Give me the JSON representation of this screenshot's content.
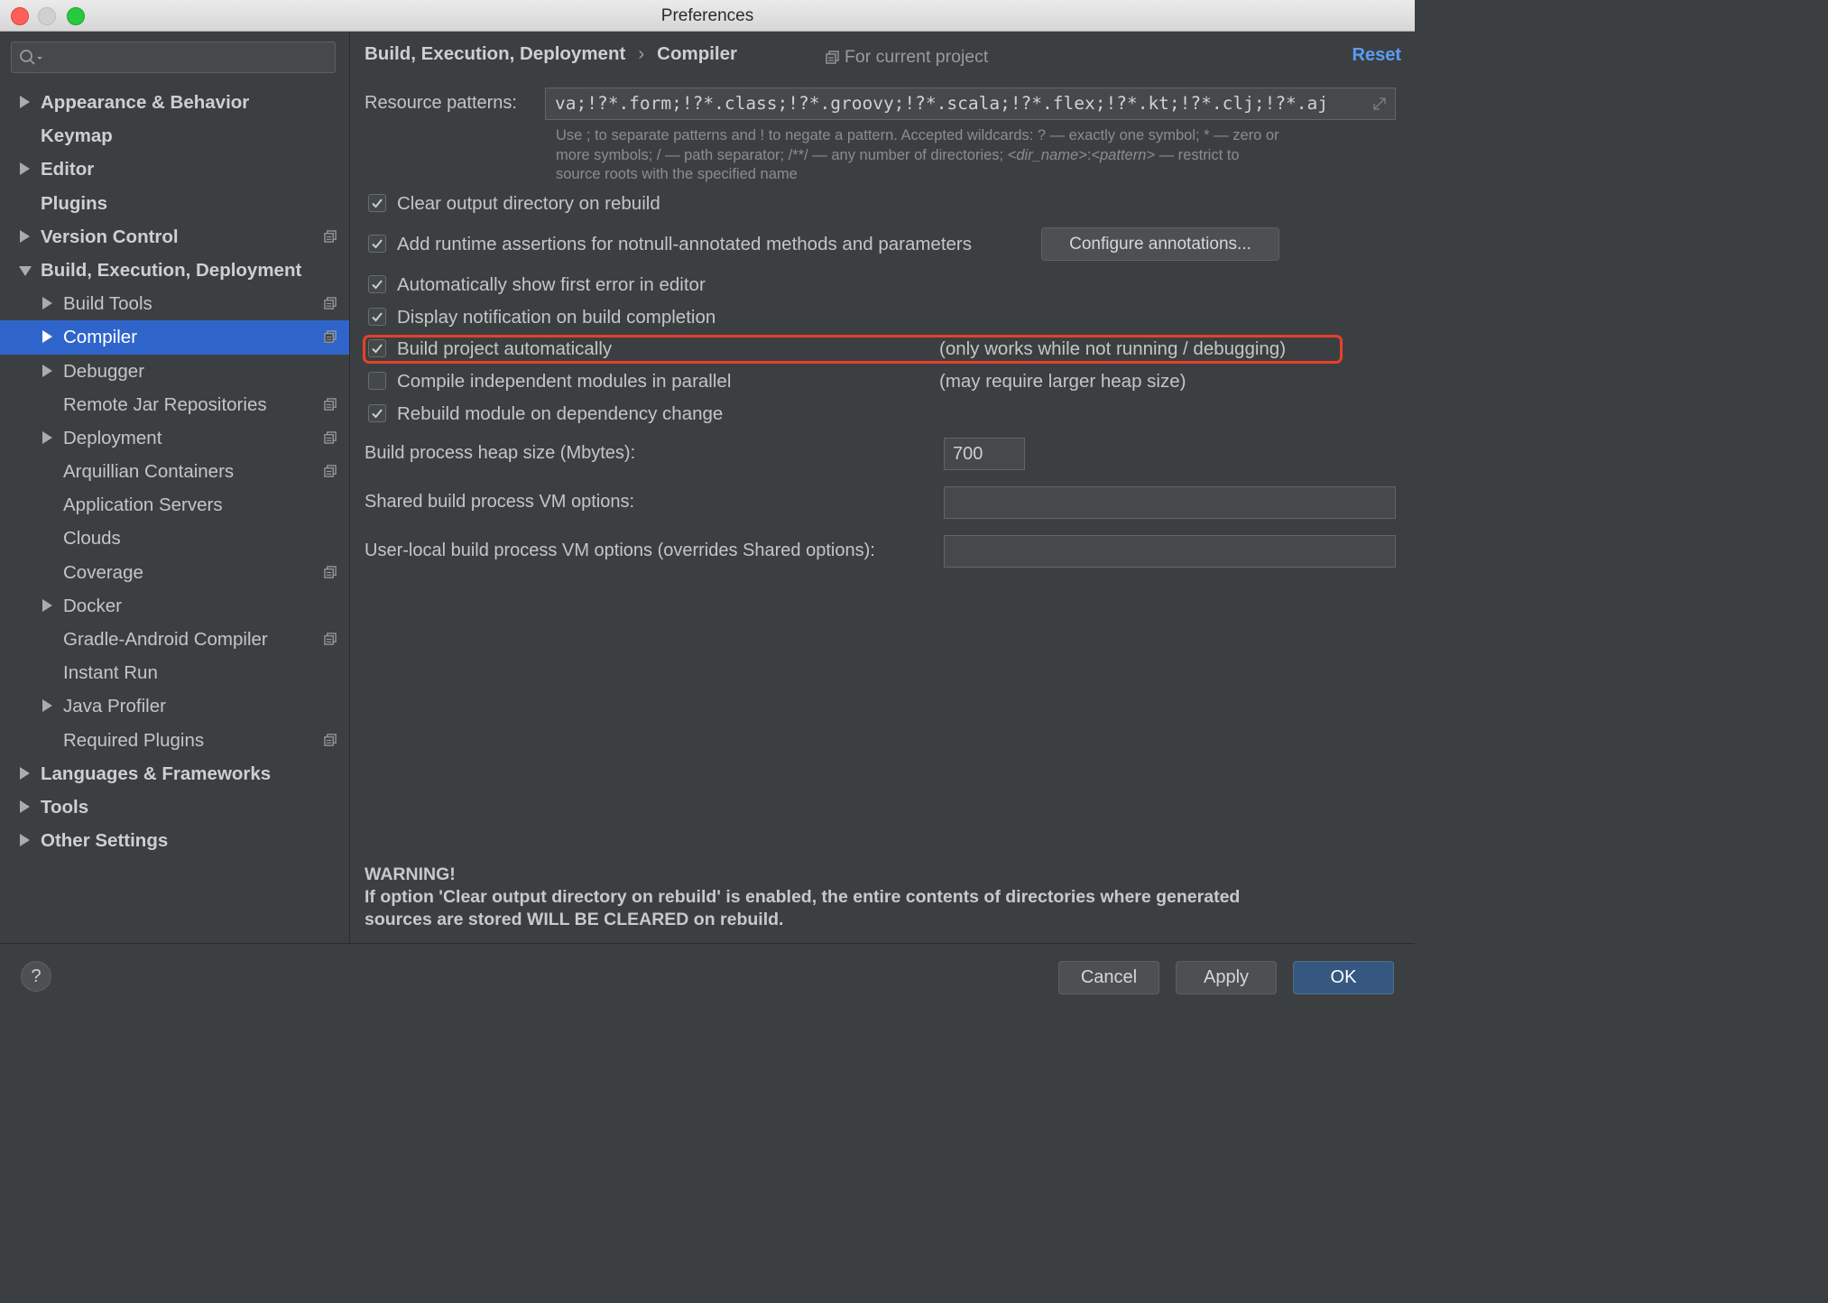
{
  "window": {
    "title": "Preferences"
  },
  "sidebar": {
    "search": {
      "placeholder": ""
    },
    "items": [
      {
        "label": "Appearance & Behavior",
        "level": 0,
        "arrow": "right",
        "project_scope": false
      },
      {
        "label": "Keymap",
        "level": 0,
        "arrow": "none",
        "project_scope": false
      },
      {
        "label": "Editor",
        "level": 0,
        "arrow": "right",
        "project_scope": false
      },
      {
        "label": "Plugins",
        "level": 0,
        "arrow": "none",
        "project_scope": false
      },
      {
        "label": "Version Control",
        "level": 0,
        "arrow": "right",
        "project_scope": true
      },
      {
        "label": "Build, Execution, Deployment",
        "level": 0,
        "arrow": "down",
        "project_scope": false
      },
      {
        "label": "Build Tools",
        "level": 1,
        "arrow": "right",
        "project_scope": true
      },
      {
        "label": "Compiler",
        "level": 1,
        "arrow": "right",
        "project_scope": true,
        "selected": true
      },
      {
        "label": "Debugger",
        "level": 1,
        "arrow": "right",
        "project_scope": false
      },
      {
        "label": "Remote Jar Repositories",
        "level": 1,
        "arrow": "none",
        "project_scope": true
      },
      {
        "label": "Deployment",
        "level": 1,
        "arrow": "right",
        "project_scope": true
      },
      {
        "label": "Arquillian Containers",
        "level": 1,
        "arrow": "none",
        "project_scope": true
      },
      {
        "label": "Application Servers",
        "level": 1,
        "arrow": "none",
        "project_scope": false
      },
      {
        "label": "Clouds",
        "level": 1,
        "arrow": "none",
        "project_scope": false
      },
      {
        "label": "Coverage",
        "level": 1,
        "arrow": "none",
        "project_scope": true
      },
      {
        "label": "Docker",
        "level": 1,
        "arrow": "right",
        "project_scope": false
      },
      {
        "label": "Gradle-Android Compiler",
        "level": 1,
        "arrow": "none",
        "project_scope": true
      },
      {
        "label": "Instant Run",
        "level": 1,
        "arrow": "none",
        "project_scope": false
      },
      {
        "label": "Java Profiler",
        "level": 1,
        "arrow": "right",
        "project_scope": false
      },
      {
        "label": "Required Plugins",
        "level": 1,
        "arrow": "none",
        "project_scope": true
      },
      {
        "label": "Languages & Frameworks",
        "level": 0,
        "arrow": "right",
        "project_scope": false
      },
      {
        "label": "Tools",
        "level": 0,
        "arrow": "right",
        "project_scope": false
      },
      {
        "label": "Other Settings",
        "level": 0,
        "arrow": "right",
        "project_scope": false
      }
    ]
  },
  "header": {
    "breadcrumb_parent": "Build, Execution, Deployment",
    "breadcrumb_separator": "›",
    "breadcrumb_current": "Compiler",
    "scope_label": "For current project",
    "reset_label": "Reset"
  },
  "compiler": {
    "resource_patterns_label": "Resource patterns:",
    "resource_patterns_value": "va;!?*.form;!?*.class;!?*.groovy;!?*.scala;!?*.flex;!?*.kt;!?*.clj;!?*.aj",
    "hint_line1": "Use ; to separate patterns and ! to negate a pattern. Accepted wildcards: ? — exactly one symbol; * — zero or",
    "hint_line2_a": "more symbols; / — path separator; /**/ — any number of directories; ",
    "hint_line2_b": "<dir_name>",
    "hint_line2_c": ":",
    "hint_line2_d": "<pattern>",
    "hint_line2_e": " — restrict to",
    "hint_line3": "source roots with the specified name",
    "options": [
      {
        "label": "Clear output directory on rebuild",
        "checked": true
      },
      {
        "label": "Add runtime assertions for notnull-annotated methods and parameters",
        "checked": true
      },
      {
        "label": "Automatically show first error in editor",
        "checked": true
      },
      {
        "label": "Display notification on build completion",
        "checked": true
      },
      {
        "label": "Build project automatically",
        "checked": true,
        "note": "(only works while not running / debugging)"
      },
      {
        "label": "Compile independent modules in parallel",
        "checked": false,
        "note": "(may require larger heap size)"
      },
      {
        "label": "Rebuild module on dependency change",
        "checked": true
      }
    ],
    "configure_annotations_label": "Configure annotations...",
    "heap_size_label": "Build process heap size (Mbytes):",
    "heap_size_value": "700",
    "shared_vm_label": "Shared build process VM options:",
    "shared_vm_value": "",
    "user_vm_label": "User-local build process VM options (overrides Shared options):",
    "user_vm_value": "",
    "warning_title": "WARNING!",
    "warning_line1": "If option 'Clear output directory on rebuild' is enabled, the entire contents of directories where generated",
    "warning_line2": "sources are stored WILL BE CLEARED on rebuild."
  },
  "footer": {
    "help_label": "?",
    "cancel_label": "Cancel",
    "apply_label": "Apply",
    "ok_label": "OK"
  },
  "colors": {
    "selection": "#2f65ca",
    "highlight_outline": "#e8402a",
    "link": "#589df6",
    "primary_button": "#365880"
  }
}
